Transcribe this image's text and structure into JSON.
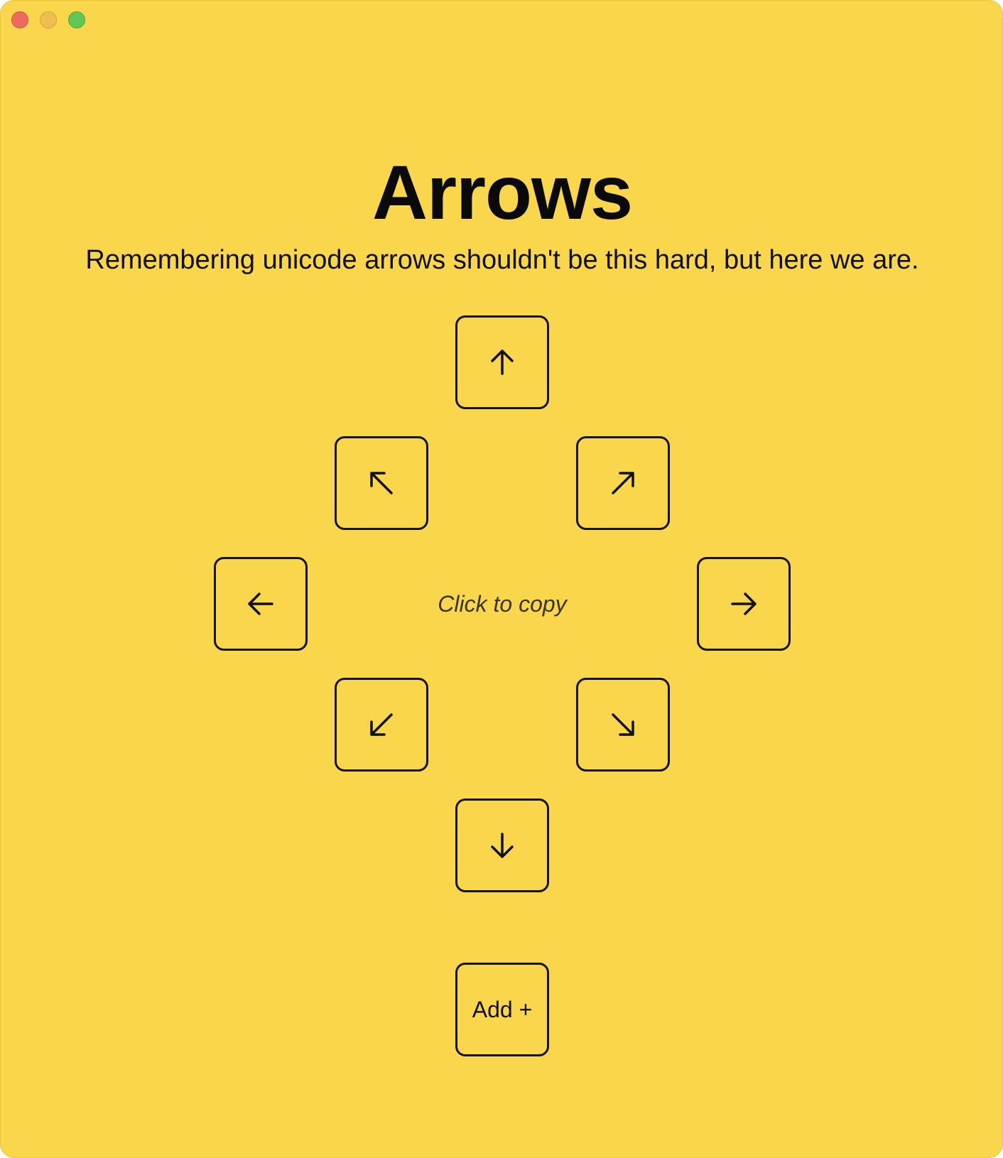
{
  "window": {
    "controls": {
      "close_icon": "close-traffic-light",
      "minimize_icon": "minimize-traffic-light",
      "zoom_icon": "zoom-traffic-light"
    },
    "background_color": "#f9d64b"
  },
  "header": {
    "title": "Arrows",
    "subtitle": "Remembering unicode arrows shouldn't be this hard, but here we are."
  },
  "arrows": {
    "up": {
      "icon": "arrow-up-icon",
      "glyph": "↑"
    },
    "up_left": {
      "icon": "arrow-up-left-icon",
      "glyph": "↖"
    },
    "up_right": {
      "icon": "arrow-up-right-icon",
      "glyph": "↗"
    },
    "left": {
      "icon": "arrow-left-icon",
      "glyph": "←"
    },
    "right": {
      "icon": "arrow-right-icon",
      "glyph": "→"
    },
    "down_left": {
      "icon": "arrow-down-left-icon",
      "glyph": "↙"
    },
    "down_right": {
      "icon": "arrow-down-right-icon",
      "glyph": "↘"
    },
    "down": {
      "icon": "arrow-down-icon",
      "glyph": "↓"
    }
  },
  "hint": "Click to copy",
  "add_button": {
    "label": "Add +"
  }
}
